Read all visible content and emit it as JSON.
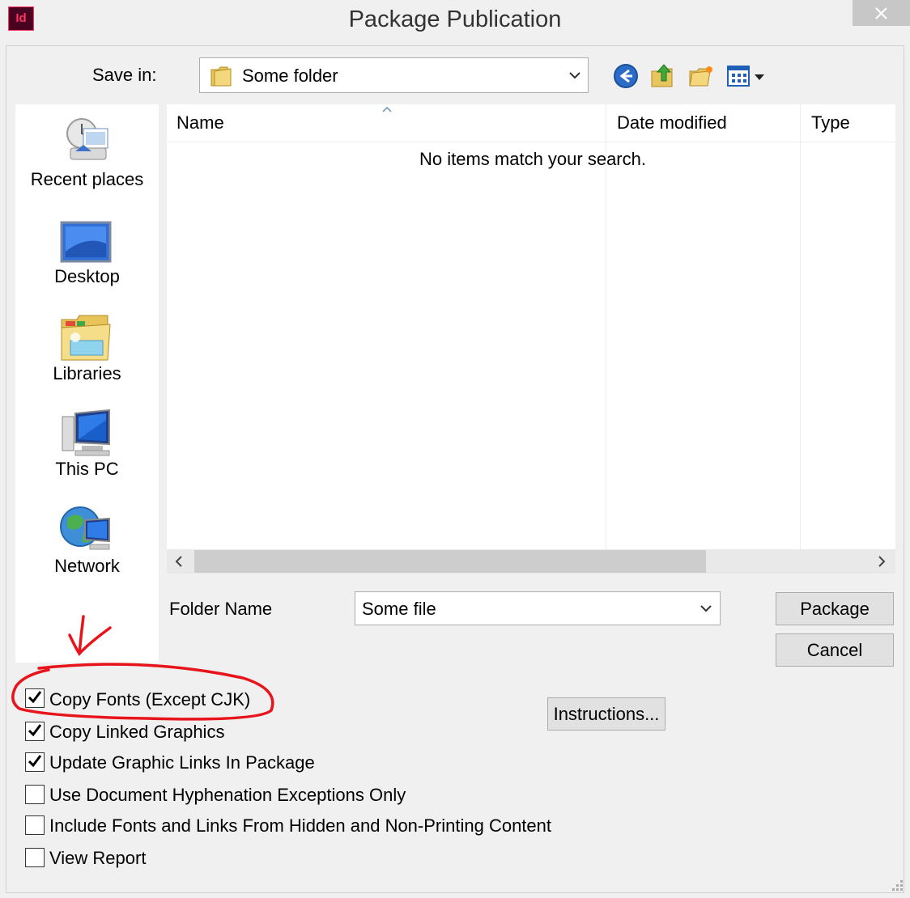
{
  "window": {
    "title": "Package Publication",
    "app_icon_text": "Id",
    "close_icon": "close-icon",
    "accent": "#ff3366"
  },
  "toolbar": {
    "save_in_label": "Save in:",
    "save_in_value": "Some folder",
    "icons": [
      "back-icon",
      "up-folder-icon",
      "new-folder-icon",
      "view-menu-icon"
    ]
  },
  "places": [
    {
      "label": "Recent places",
      "icon": "recent-places-icon"
    },
    {
      "label": "Desktop",
      "icon": "desktop-icon"
    },
    {
      "label": "Libraries",
      "icon": "libraries-icon"
    },
    {
      "label": "This PC",
      "icon": "this-pc-icon"
    },
    {
      "label": "Network",
      "icon": "network-icon"
    }
  ],
  "file_list": {
    "columns": [
      "Name",
      "Date modified",
      "Type"
    ],
    "empty_message": "No items match your search."
  },
  "folder_name": {
    "label": "Folder Name",
    "value": "Some file"
  },
  "buttons": {
    "package": "Package",
    "cancel": "Cancel",
    "instructions": "Instructions..."
  },
  "options": [
    {
      "label": "Copy Fonts (Except CJK)",
      "checked": true
    },
    {
      "label": "Copy Linked Graphics",
      "checked": true
    },
    {
      "label": "Update Graphic Links In Package",
      "checked": true
    },
    {
      "label": "Use Document Hyphenation Exceptions Only",
      "checked": false
    },
    {
      "label": "Include Fonts and Links From Hidden and Non-Printing Content",
      "checked": false
    },
    {
      "label": "View Report",
      "checked": false
    }
  ],
  "annotation": {
    "color": "#e8141c"
  }
}
